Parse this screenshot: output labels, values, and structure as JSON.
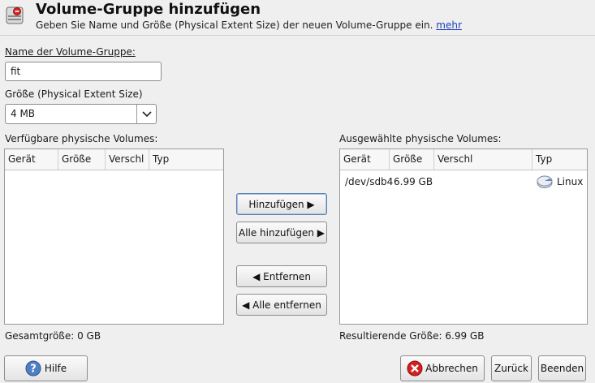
{
  "header": {
    "title": "Volume-Gruppe hinzufügen",
    "subtitle": "Geben Sie Name und Größe (Physical Extent Size) der neuen Volume-Gruppe ein.",
    "more_link": "mehr"
  },
  "form": {
    "name_label": "Name der Volume-Gruppe:",
    "name_value": "fit",
    "size_label": "Größe (Physical Extent Size)",
    "size_value": "4 MB"
  },
  "available": {
    "label": "Verfügbare physische Volumes:",
    "columns": [
      "Gerät",
      "Größe",
      "Verschl",
      "Typ"
    ],
    "rows": [],
    "total": "Gesamtgröße: 0 GB"
  },
  "selected": {
    "label": "Ausgewählte physische Volumes:",
    "columns": [
      "Gerät",
      "Größe",
      "Verschl",
      "Typ"
    ],
    "rows": [
      {
        "device": "/dev/sdb4",
        "size": "6.99 GB",
        "lock": "",
        "type": "Linux"
      }
    ],
    "total": "Resultierende Größe: 6.99 GB"
  },
  "actions": {
    "add": "Hinzufügen ▶",
    "add_all": "Alle hinzufügen ▶",
    "remove": "◀ Entfernen",
    "remove_all": "◀ Alle entfernen"
  },
  "footer": {
    "help": "Hilfe",
    "cancel": "Abbrechen",
    "back": "Zurück",
    "finish": "Beenden"
  },
  "icons": {
    "header": "disk-add-icon",
    "help": "help-icon",
    "cancel": "cancel-icon",
    "linux": "disk-icon",
    "dropdown": "chevron-down-icon"
  }
}
